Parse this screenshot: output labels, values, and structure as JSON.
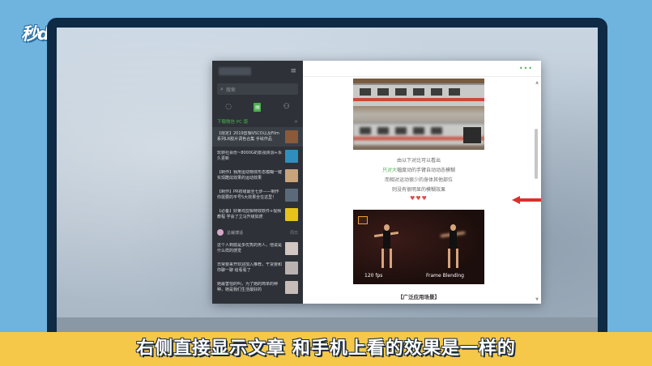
{
  "logo": {
    "text": "秒dong视频"
  },
  "subtitle": "右侧直接显示文章 和手机上看的效果是一样的",
  "app": {
    "sidebar": {
      "search_placeholder": "搜索",
      "feed_section_title": "下载微信 PC 版",
      "feed_items": [
        {
          "text": "【限定】2019剪辑VSCO以及Film系列LR胶片调色合集 手绘作品",
          "thumb": "#8a5a3a"
        },
        {
          "text": "玩转社会份~8000G的影视资源+永久更新",
          "thumb": "#2e8fbf"
        },
        {
          "text": "【制作】我用运动物体形态模糊一键实现酷炫效果的运动效果",
          "thumb": "#c9a37a"
        },
        {
          "text": "【制作】PR初级最全七步——制作你需要的平号5大效果全在这里！",
          "thumb": "#5a6a7a"
        },
        {
          "text": "【必备】好莱坞剪辑特效软件+视频教程 学会了立马升级如虎",
          "thumb": "#e6c21a"
        }
      ],
      "chat_section_title": "总裁博话",
      "chat_section_sub": "周日",
      "chat_items": [
        {
          "text": "这个人到底是多优秀的男人，他说是什么样的感觉",
          "thumb": "#d1c6c2"
        },
        {
          "text": "日常要来开欢迎加入推荐，干货要和你聊一聊 给看看了",
          "thumb": "#b9b2b0"
        },
        {
          "text": "她最害怕的叫，为了她的简单的种种，她是我们生活最好的",
          "thumb": "#c8bcb8"
        }
      ]
    },
    "content": {
      "top_dots": "•••",
      "line1_pre": "",
      "line1": "由以下对比可以看出",
      "line2_hl": "只对大",
      "line2": "幅度动的手臂自动动态模糊",
      "line3": "而相对运动很少的身体其他部位",
      "line4": "则没有很明显的模糊效果",
      "hearts": "♥♥♥",
      "dance_left_label": "120 fps",
      "dance_right_label": "Frame Blending",
      "section_title": "【广泛应用场景】"
    }
  },
  "colors": {
    "background": "#6fb3df",
    "monitor_frame": "#0e2a45",
    "subtitle_bar": "#f5c84a",
    "sidebar": "#2e3238",
    "accent_green": "#4caf50",
    "arrow_red": "#d9302c"
  }
}
